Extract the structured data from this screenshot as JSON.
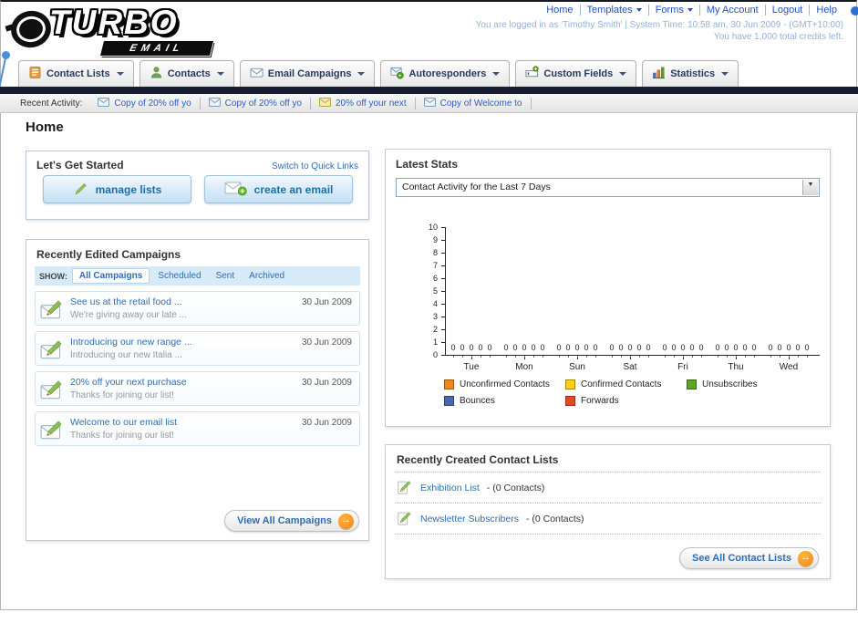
{
  "header": {
    "logo_primary": "TURBO",
    "logo_secondary": "EMAIL",
    "nav": [
      {
        "label": "Home"
      },
      {
        "label": "Templates",
        "has_menu": true
      },
      {
        "label": "Forms",
        "has_menu": true
      },
      {
        "label": "My Account"
      },
      {
        "label": "Logout"
      },
      {
        "label": "Help"
      }
    ],
    "login_line": "You are logged in as 'Timothy Smith' | System Time: 10:58 am, 30 Jun 2009 - (GMT+10:00)",
    "credits_line": "You have 1,000 total credits left."
  },
  "tabs": [
    {
      "label": "Contact Lists",
      "icon": "contact-lists-icon"
    },
    {
      "label": "Contacts",
      "icon": "contacts-icon"
    },
    {
      "label": "Email Campaigns",
      "icon": "email-campaigns-icon"
    },
    {
      "label": "Autoresponders",
      "icon": "autoresponders-icon"
    },
    {
      "label": "Custom Fields",
      "icon": "custom-fields-icon"
    },
    {
      "label": "Statistics",
      "icon": "statistics-icon"
    }
  ],
  "recent_activity": {
    "label": "Recent Activity:",
    "items": [
      {
        "label": "Copy of 20% off yo"
      },
      {
        "label": "Copy of 20% off yo"
      },
      {
        "label": "20% off your next"
      },
      {
        "label": "Copy of Welcome to"
      }
    ]
  },
  "page_title": "Home",
  "get_started": {
    "title": "Let's Get Started",
    "switch_link": "Switch to Quick Links",
    "manage_lists_label": "manage lists",
    "create_email_label": "create an email"
  },
  "campaigns": {
    "title": "Recently Edited Campaigns",
    "show_label": "SHOW:",
    "filters": [
      {
        "label": "All Campaigns",
        "selected": true
      },
      {
        "label": "Scheduled",
        "selected": false
      },
      {
        "label": "Sent",
        "selected": false
      },
      {
        "label": "Archived",
        "selected": false
      }
    ],
    "items": [
      {
        "title": "See us at the retail food ...",
        "subtitle": "We're giving away our late ...",
        "date": "30 Jun 2009"
      },
      {
        "title": "Introducing our new range ...",
        "subtitle": "Introducing our new Italia ...",
        "date": "30 Jun 2009"
      },
      {
        "title": "20% off your next purchase",
        "subtitle": "Thanks for joining our list!",
        "date": "30 Jun 2009"
      },
      {
        "title": "Welcome to our email list",
        "subtitle": "Thanks for joining our list!",
        "date": "30 Jun 2009"
      }
    ],
    "view_all_label": "View All Campaigns"
  },
  "stats": {
    "title": "Latest Stats",
    "selected_option": "Contact Activity for the Last 7 Days",
    "legend": [
      {
        "label": "Unconfirmed Contacts",
        "color": "#f28718"
      },
      {
        "label": "Confirmed Contacts",
        "color": "#ffd012"
      },
      {
        "label": "Unsubscribes",
        "color": "#5ca525"
      },
      {
        "label": "Bounces",
        "color": "#4a69a8"
      },
      {
        "label": "Forwards",
        "color": "#e2491f"
      }
    ],
    "chart_data": {
      "type": "bar",
      "title": "Contact Activity for the Last 7 Days",
      "categories": [
        "Tue",
        "Mon",
        "Sun",
        "Sat",
        "Fri",
        "Thu",
        "Wed"
      ],
      "series": [
        {
          "name": "Unconfirmed Contacts",
          "color": "#f28718",
          "values": [
            0,
            0,
            0,
            0,
            0,
            0,
            0
          ]
        },
        {
          "name": "Confirmed Contacts",
          "color": "#ffd012",
          "values": [
            0,
            0,
            0,
            0,
            0,
            0,
            0
          ]
        },
        {
          "name": "Unsubscribes",
          "color": "#5ca525",
          "values": [
            0,
            0,
            0,
            0,
            0,
            0,
            0
          ]
        },
        {
          "name": "Bounces",
          "color": "#4a69a8",
          "values": [
            0,
            0,
            0,
            0,
            0,
            0,
            0
          ]
        },
        {
          "name": "Forwards",
          "color": "#e2491f",
          "values": [
            0,
            0,
            0,
            0,
            0,
            0,
            0
          ]
        }
      ],
      "xlabel": "",
      "ylabel": "",
      "ylim": [
        0,
        10
      ],
      "y_tick_step": 1,
      "grid": false,
      "legend_position": "bottom",
      "value_labels_shown": true
    }
  },
  "contact_lists": {
    "title": "Recently Created Contact Lists",
    "items": [
      {
        "name": "Exhibition List",
        "detail": " - (0 Contacts)"
      },
      {
        "name": "Newsletter Subscribers",
        "detail": " - (0 Contacts)"
      }
    ],
    "see_all_label": "See All Contact Lists"
  }
}
